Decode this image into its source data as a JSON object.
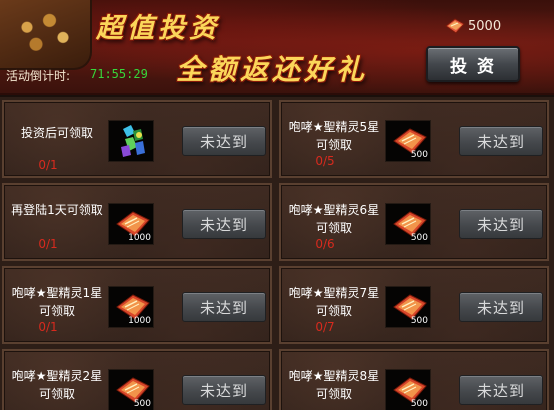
{
  "banner": {
    "title_line1": "超值投资",
    "title_line2": "全额返还好礼",
    "countdown_label": "活动倒计时:",
    "countdown_value": "71:55:29",
    "currency_amount": "5000",
    "invest_button": "投 资"
  },
  "colors": {
    "title_gold": "#fbd65a",
    "countdown_green": "#37d63a",
    "progress_red": "#d72a1e"
  },
  "rewards": [
    {
      "label": "投资后可领取",
      "progress": "0/1",
      "item_icon": "gem-bundle-icon",
      "quantity": "",
      "status": "未达到"
    },
    {
      "label": "咆哮★聖精灵5星可领取",
      "progress": "0/5",
      "item_icon": "gold-ingot-icon",
      "quantity": "500",
      "status": "未达到"
    },
    {
      "label": "再登陆1天可领取",
      "progress": "0/1",
      "item_icon": "gold-ingot-icon",
      "quantity": "1000",
      "status": "未达到"
    },
    {
      "label": "咆哮★聖精灵6星可领取",
      "progress": "0/6",
      "item_icon": "gold-ingot-icon",
      "quantity": "500",
      "status": "未达到"
    },
    {
      "label": "咆哮★聖精灵1星可领取",
      "progress": "0/1",
      "item_icon": "gold-ingot-icon",
      "quantity": "1000",
      "status": "未达到"
    },
    {
      "label": "咆哮★聖精灵7星可领取",
      "progress": "0/7",
      "item_icon": "gold-ingot-icon",
      "quantity": "500",
      "status": "未达到"
    },
    {
      "label": "咆哮★聖精灵2星可领取",
      "progress": "",
      "item_icon": "gold-ingot-icon",
      "quantity": "500",
      "status": "未达到"
    },
    {
      "label": "咆哮★聖精灵8星可领取",
      "progress": "",
      "item_icon": "gold-ingot-icon",
      "quantity": "500",
      "status": "未达到"
    }
  ]
}
